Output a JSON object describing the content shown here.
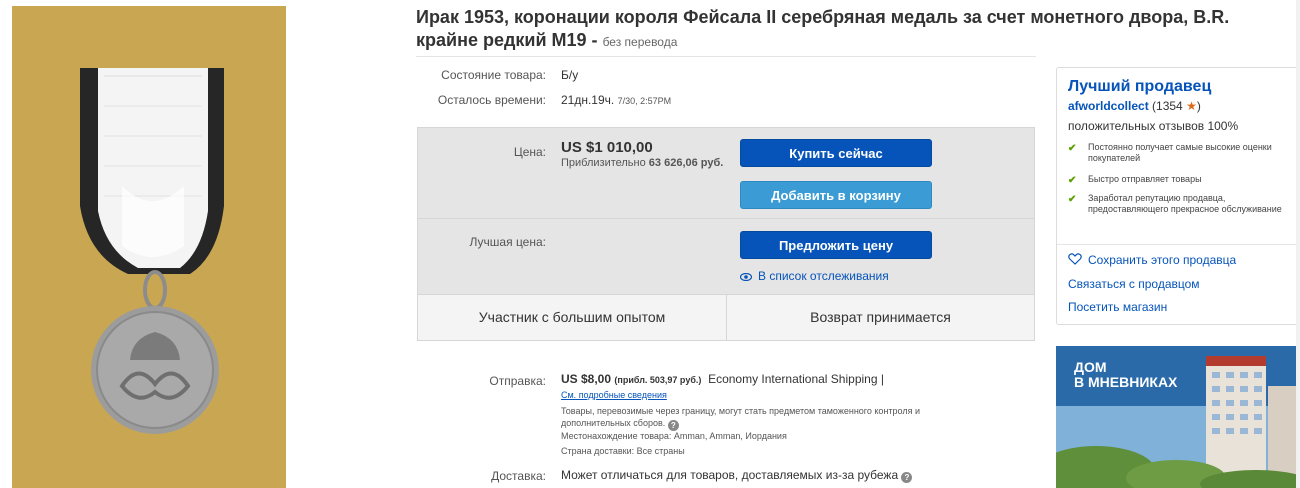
{
  "title": {
    "main": "Ирак 1953, коронации короля Фейсала II серебряная медаль за счет монетного двора, B.R. крайне редкий M19 -",
    "subtitle": "без перевода"
  },
  "details": {
    "condition_label": "Состояние товара:",
    "condition_value": "Б/у",
    "time_label": "Осталось времени:",
    "time_value": "21дн.19ч.",
    "time_end": "7/30, 2:57PM"
  },
  "price": {
    "label": "Цена:",
    "value": "US $1 010,00",
    "approx_prefix": "Приблизительно",
    "approx_value": "63 626,06 руб.",
    "buy_now": "Купить сейчас",
    "add_to_cart": "Добавить в корзину",
    "best_offer_label": "Лучшая цена:",
    "make_offer": "Предложить цену",
    "watchlist": "В список отслеживания",
    "experienced": "Участник с большим опытом",
    "returns": "Возврат принимается"
  },
  "shipping": {
    "label": "Отправка:",
    "cost": "US $8,00",
    "approx": "(прибл. 503,97 руб.)",
    "method": "Economy International Shipping |",
    "details_link": "См. подробные сведения",
    "customs_note": "Товары, перевозимые через границу, могут стать предметом таможенного контроля и дополнительных сборов.",
    "location": "Местонахождение товара:  Amman, Amman, Иордания",
    "ships_to": "Страна доставки:  Все страны",
    "delivery_label": "Доставка:",
    "delivery_value": "Может отличаться для товаров, доставляемых из-за рубежа"
  },
  "seller": {
    "heading": "Лучший продавец",
    "name": "afworldcollect",
    "score": "(1354",
    "score_close": ")",
    "feedback": "положительных отзывов 100%",
    "points": [
      "Постоянно получает самые высокие оценки покупателей",
      "Быстро отправляет товары",
      "Заработал репутацию продавца, предоставляющего прекрасное обслуживание"
    ],
    "save_seller": "Сохранить этого продавца",
    "contact": "Связаться с продавцом",
    "visit_store": "Посетить магазин"
  },
  "ad": {
    "line1": "ДОМ",
    "line2": "В МНЕВНИКАХ"
  },
  "colors": {
    "link": "#0654ba",
    "primary_button": "#0654ba",
    "secondary_button": "#3a9bd5",
    "star": "#dd6a1b",
    "check": "#5ba100",
    "photo_background": "#c8a650"
  }
}
